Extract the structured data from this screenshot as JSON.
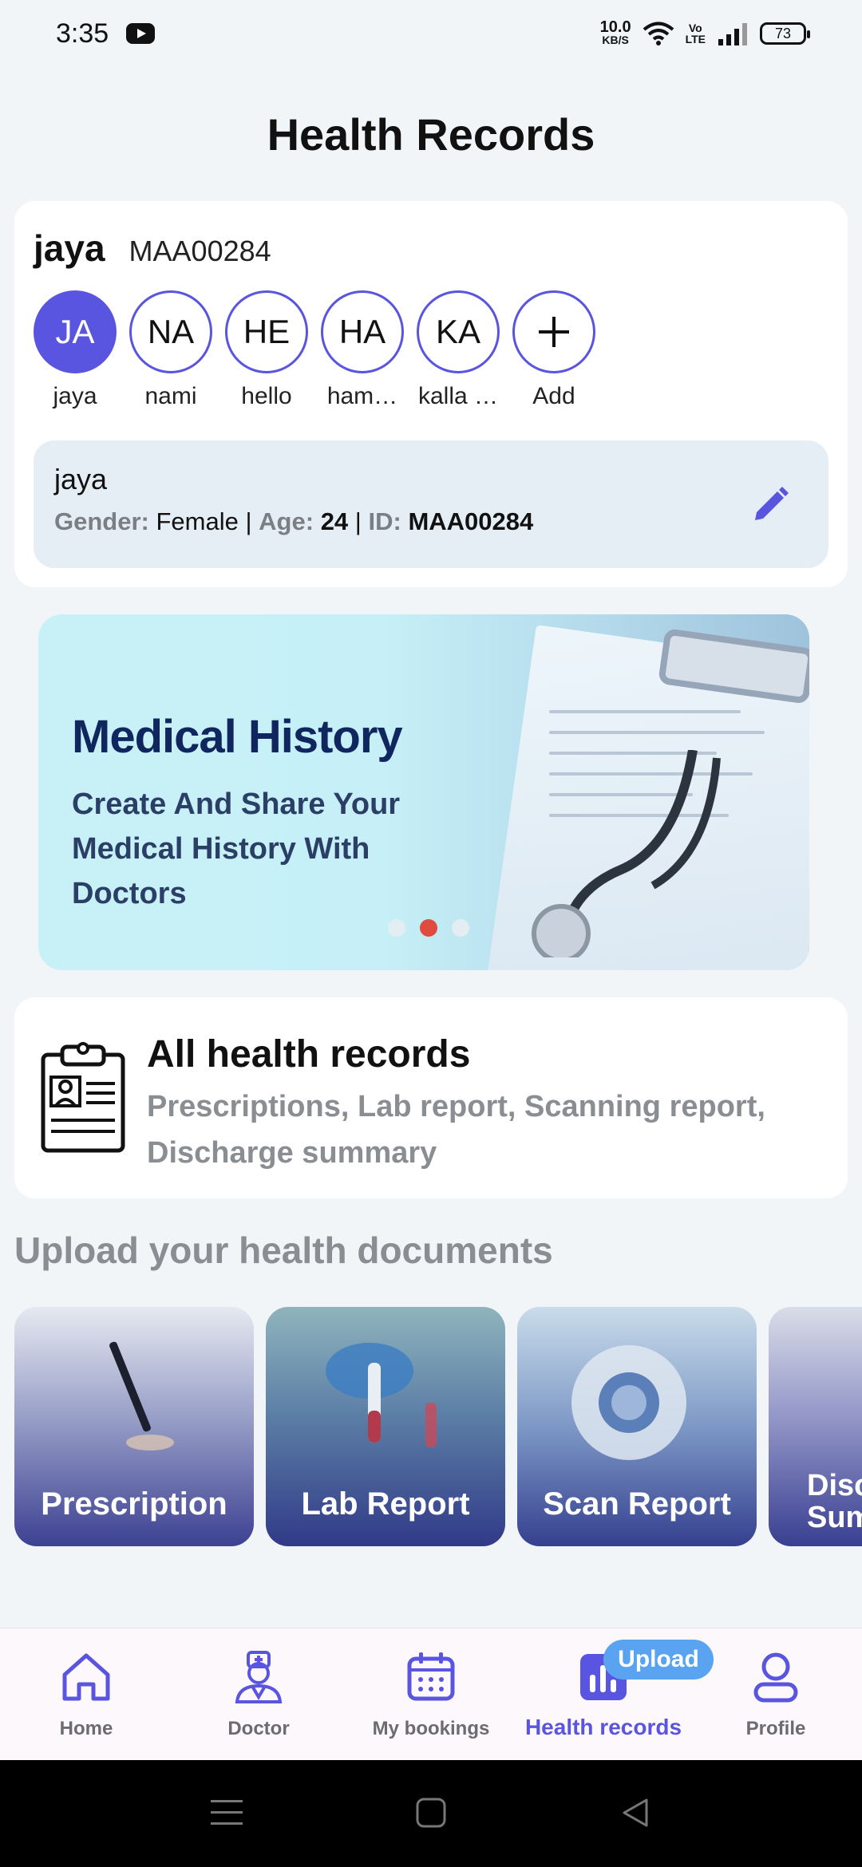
{
  "status_bar": {
    "time": "3:35",
    "net_speed_value": "10.0",
    "net_speed_unit": "KB/S",
    "volte_top": "Vo",
    "volte_bottom": "LTE",
    "battery": "73"
  },
  "page": {
    "title": "Health Records"
  },
  "profile": {
    "name": "jaya",
    "id": "MAA00284",
    "members": [
      {
        "initials": "JA",
        "label": "jaya",
        "active": true
      },
      {
        "initials": "NA",
        "label": "nami",
        "active": false
      },
      {
        "initials": "HE",
        "label": "hello",
        "active": false
      },
      {
        "initials": "HA",
        "label": "ham…",
        "active": false
      },
      {
        "initials": "KA",
        "label": "kalla …",
        "active": false
      }
    ],
    "add_label": "Add",
    "details": {
      "name": "jaya",
      "gender_label": "Gender:",
      "gender": "Female",
      "separator": "|",
      "age_label": "Age:",
      "age": "24",
      "id_label": "ID:",
      "id": "MAA00284"
    }
  },
  "banner": {
    "title": "Medical History",
    "subtitle": "Create And Share Your Medical History With Doctors",
    "active_slide": 2,
    "slide_count": 3
  },
  "records": {
    "title": "All health records",
    "subtitle": "Prescriptions, Lab report, Scanning report, Discharge summary"
  },
  "upload": {
    "heading": "Upload your health documents",
    "tiles": [
      {
        "label": "Prescription"
      },
      {
        "label": "Lab Report"
      },
      {
        "label": "Scan Report"
      },
      {
        "label": "Discharge Summary"
      }
    ]
  },
  "bottom_nav": {
    "items": [
      {
        "label": "Home",
        "icon": "home-icon"
      },
      {
        "label": "Doctor",
        "icon": "doctor-icon"
      },
      {
        "label": "My bookings",
        "icon": "calendar-icon"
      },
      {
        "label": "Health records",
        "icon": "bar-chart-icon",
        "active": true
      },
      {
        "label": "Profile",
        "icon": "person-icon"
      }
    ],
    "upload_badge": "Upload",
    "active_color": "#5a55e0"
  },
  "colors": {
    "accent": "#5a55e0",
    "background": "#f1f5f7",
    "banner_title": "#10265e",
    "dot_active": "#e04b3f",
    "upload_badge": "#5aa3f0"
  }
}
